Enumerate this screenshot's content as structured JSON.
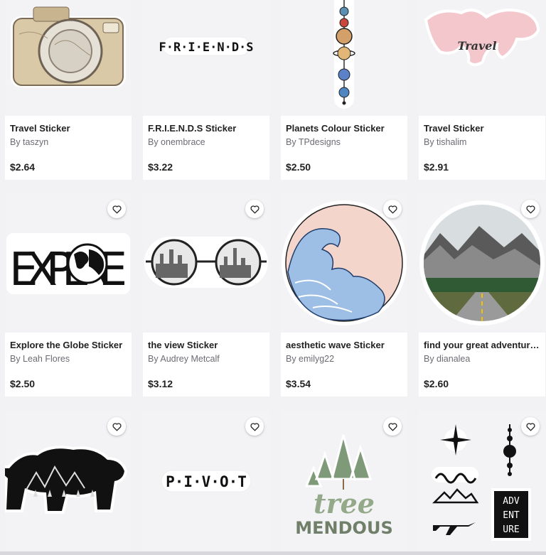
{
  "products": [
    {
      "title": "Travel Sticker",
      "artist": "By taszyn",
      "price": "$2.64",
      "image": "vintage-map-camera-sticker"
    },
    {
      "title": "F.R.I.E.N.D.S Sticker",
      "artist": "By onembrace",
      "price": "$3.22",
      "image": "friends-logo-text",
      "text": "F·R·I·E·N·D·S"
    },
    {
      "title": "Planets Colour Sticker",
      "artist": "By TPdesigns",
      "price": "$2.50",
      "image": "vertical-planets-sticker"
    },
    {
      "title": "Travel Sticker",
      "artist": "By tishalim",
      "price": "$2.91",
      "image": "pink-world-map-sticker",
      "text": "Travel"
    },
    {
      "title": "Explore the Globe Sticker",
      "artist": "By Leah Flores",
      "price": "$2.50",
      "image": "explore-globe-lettering",
      "text": "EXPL  RE"
    },
    {
      "title": "the view Sticker",
      "artist": "By Audrey Metcalf",
      "price": "$3.12",
      "image": "city-skyline-glasses-sticker"
    },
    {
      "title": "aesthetic wave Sticker",
      "artist": "By emilyg22",
      "price": "$3.54",
      "image": "great-wave-circle-sticker"
    },
    {
      "title": "find your great adventure Sticker",
      "artist": "By dianalea",
      "price": "$2.60",
      "image": "mountain-road-circle-sticker"
    },
    {
      "title": "",
      "artist": "",
      "price": "",
      "image": "forest-bear-silhouette-sticker"
    },
    {
      "title": "",
      "artist": "",
      "price": "",
      "image": "pivot-text-sticker",
      "text": "P·I·V·O·T"
    },
    {
      "title": "",
      "artist": "",
      "price": "",
      "image": "tree-mendous-sticker",
      "text": "tree",
      "text2": "MENDOUS"
    },
    {
      "title": "",
      "artist": "",
      "price": "",
      "image": "adventure-icons-sticker",
      "text": [
        "ADV",
        "ENT",
        "URE"
      ]
    }
  ],
  "icons": {
    "favorite": "heart-outline-icon"
  },
  "colors": {
    "background": "#f2f2f4",
    "card": "#ffffff",
    "text": "#222222",
    "muted": "#6b6b73"
  }
}
